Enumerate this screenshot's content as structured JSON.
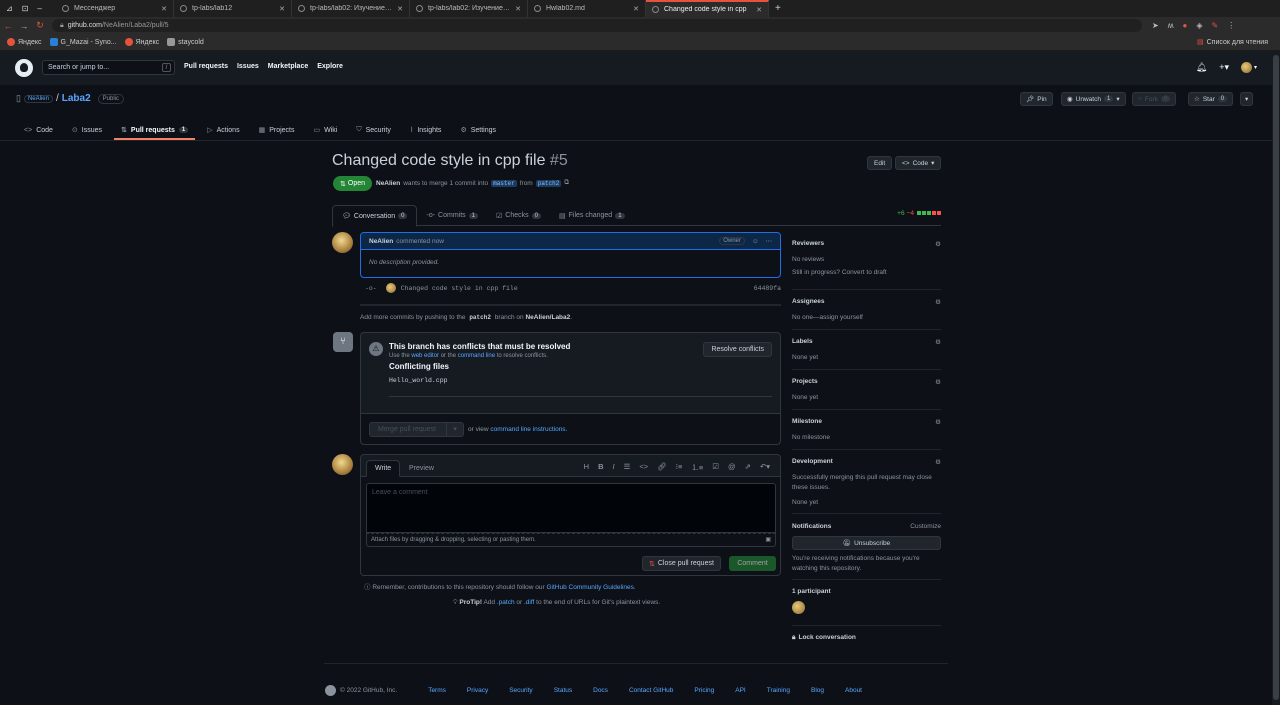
{
  "browser": {
    "tabs": [
      {
        "label": "Мессенджер",
        "active": false
      },
      {
        "label": "tp-labs/lab12",
        "active": false
      },
      {
        "label": "tp-labs/lab02: Изучение си",
        "active": false
      },
      {
        "label": "tp-labs/lab02: Изучение си",
        "active": false
      },
      {
        "label": "Hwlab02.md",
        "active": false
      },
      {
        "label": "Changed code style in cpp",
        "active": true
      }
    ],
    "url_host": "github.com",
    "url_path": "/NeAlien/Laba2/pull/5",
    "bookmarks": [
      "Яндекс",
      "G_Mazai - Syno...",
      "Яндекс",
      "staycold"
    ],
    "reading_list": "Список для чтения"
  },
  "github": {
    "search_placeholder": "Search or jump to...",
    "search_key": "/",
    "nav": [
      "Pull requests",
      "Issues",
      "Marketplace",
      "Explore"
    ]
  },
  "repo": {
    "owner": "NeAlien",
    "separator": "/",
    "name": "Laba2",
    "visibility": "Public",
    "pin": "Pin",
    "unwatch": "Unwatch",
    "unwatch_count": "1",
    "fork": "Fork",
    "fork_count": "0",
    "star": "Star",
    "star_count": "0",
    "tabs": [
      {
        "label": "Code",
        "icon": "<>"
      },
      {
        "label": "Issues",
        "icon": "⊙"
      },
      {
        "label": "Pull requests",
        "icon": "⇅",
        "count": "1"
      },
      {
        "label": "Actions",
        "icon": "▷"
      },
      {
        "label": "Projects",
        "icon": "▦"
      },
      {
        "label": "Wiki",
        "icon": "▭"
      },
      {
        "label": "Security",
        "icon": "⛉"
      },
      {
        "label": "Insights",
        "icon": "⌇"
      },
      {
        "label": "Settings",
        "icon": "⚙"
      }
    ]
  },
  "pr": {
    "title": "Changed code style in cpp file",
    "number": "#5",
    "state": "Open",
    "author": "NeAlien",
    "merge_text": "wants to merge 1 commit into",
    "base": "master",
    "from": "from",
    "head": "patch2",
    "edit": "Edit",
    "code": "Code",
    "tabs": [
      {
        "label": "Conversation",
        "count": "0"
      },
      {
        "label": "Commits",
        "count": "1"
      },
      {
        "label": "Checks",
        "count": "0"
      },
      {
        "label": "Files changed",
        "count": "1"
      }
    ],
    "additions": "+6",
    "deletions": "−4"
  },
  "timeline": {
    "comment_author": "NeAlien",
    "comment_action": "commented now",
    "owner_badge": "Owner",
    "comment_body": "No description provided.",
    "commit_msg": "Changed code style in cpp file",
    "commit_sha": "64489fa",
    "add_more_pre": "Add more commits by pushing to the",
    "add_more_branch": "patch2",
    "add_more_mid": "branch on",
    "add_more_repo": "NeAlien/Laba2",
    "add_more_end": "."
  },
  "merge": {
    "title": "This branch has conflicts that must be resolved",
    "sub_pre": "Use the",
    "sub_link1": "web editor",
    "sub_mid": "or the",
    "sub_link2": "command line",
    "sub_end": "to resolve conflicts.",
    "conflicting": "Conflicting files",
    "file": "Hello_world.cpp",
    "resolve": "Resolve conflicts",
    "merge_button": "Merge pull request",
    "or_view": "or view",
    "cli_link": "command line instructions."
  },
  "editor": {
    "write": "Write",
    "preview": "Preview",
    "placeholder": "Leave a comment",
    "attach": "Attach files by dragging & dropping, selecting or pasting them.",
    "close_pr": "Close pull request",
    "comment": "Comment",
    "remember_pre": "Remember, contributions to this repository should follow our",
    "remember_link": "GitHub Community Guidelines",
    "remember_end": ".",
    "protip_label": "ProTip!",
    "protip_pre": "Add",
    "protip_patch": ".patch",
    "protip_or": "or",
    "protip_diff": ".diff",
    "protip_end": "to the end of URLs for Git's plaintext views."
  },
  "sidebar": {
    "reviewers": "Reviewers",
    "no_reviews": "No reviews",
    "still_progress": "Still in progress? Convert to draft",
    "assignees": "Assignees",
    "no_one": "No one—assign yourself",
    "labels": "Labels",
    "labels_none": "None yet",
    "projects": "Projects",
    "projects_none": "None yet",
    "milestone": "Milestone",
    "no_milestone": "No milestone",
    "development": "Development",
    "dev_text": "Successfully merging this pull request may close these issues.",
    "dev_none": "None yet",
    "notifications": "Notifications",
    "customize": "Customize",
    "unsubscribe": "Unsubscribe",
    "notif_text": "You're receiving notifications because you're watching this repository.",
    "participants": "1 participant",
    "lock": "Lock conversation"
  },
  "footer": {
    "copyright": "© 2022 GitHub, Inc.",
    "links": [
      "Terms",
      "Privacy",
      "Security",
      "Status",
      "Docs",
      "Contact GitHub",
      "Pricing",
      "API",
      "Training",
      "Blog",
      "About"
    ]
  }
}
